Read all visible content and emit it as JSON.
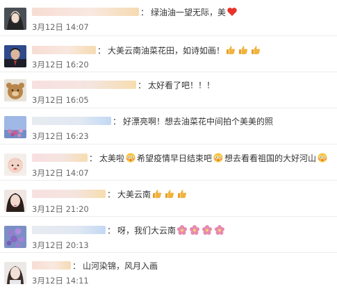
{
  "comments": [
    {
      "text": "绿油油一望无际，美",
      "date": "3月12日",
      "time": "14:07"
    },
    {
      "text": "大美云南油菜花田，如诗如画！",
      "date": "3月12日",
      "time": "16:20"
    },
    {
      "text": "太好看了吧！！！",
      "date": "3月12日",
      "time": "16:05"
    },
    {
      "text": "好漂亮啊！想去油菜花中间拍个美美的照",
      "date": "3月12日",
      "time": "16:23"
    },
    {
      "text_1": "太美啦",
      "text_2": "希望疫情早日结束吧",
      "text_3": "想去看看祖国的大好河山",
      "date": "3月12日",
      "time": "14:07"
    },
    {
      "text": "大美云南",
      "date": "3月12日",
      "time": "21:20"
    },
    {
      "text": "呀，我们大云南",
      "date": "3月12日",
      "time": "20:13"
    },
    {
      "text": "山河染锦，风月入画",
      "date": "3月12日",
      "time": "14:11"
    }
  ],
  "ui": {
    "colon": "："
  },
  "icons": [
    "heart-emoji",
    "thumbs-up-emoji",
    "flushed-face-emoji",
    "flower-emoji"
  ],
  "colors": {
    "heart": "#e8332b",
    "thumb": "#f2b33d",
    "flower": "#e68ab0"
  }
}
